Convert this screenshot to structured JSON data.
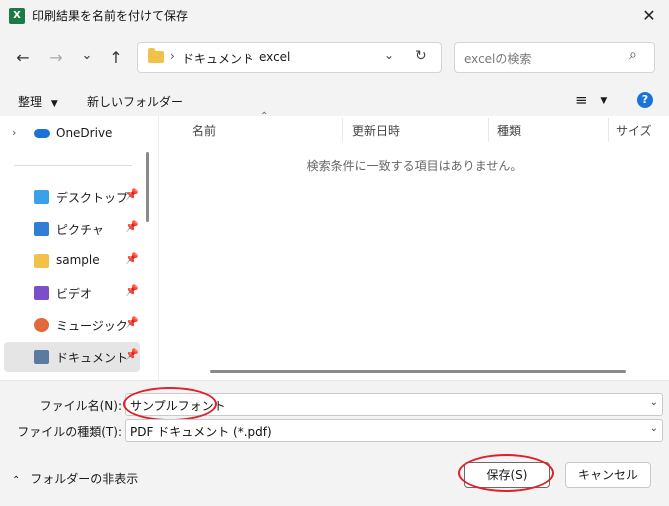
{
  "window": {
    "title": "印刷結果を名前を付けて保存",
    "app_icon_letter": "X"
  },
  "nav": {
    "back": "←",
    "forward": "→",
    "recent": "⌄",
    "up": "↑",
    "breadcrumb": [
      "ドキュメント",
      "excel"
    ],
    "chevron": "›",
    "search_placeholder": "excelの検索"
  },
  "toolbar": {
    "organize": "整理",
    "new_folder": "新しいフォルダー"
  },
  "sidebar": {
    "top": {
      "label": "OneDrive",
      "icon": "cloud-icon"
    },
    "items": [
      {
        "label": "デスクトップ",
        "icon": "desktop-icon",
        "color": "#3aa0e8"
      },
      {
        "label": "ピクチャ",
        "icon": "pictures-icon",
        "color": "#2f7fd6"
      },
      {
        "label": "sample",
        "icon": "folder-icon",
        "color": "#f3c14a"
      },
      {
        "label": "ビデオ",
        "icon": "video-icon",
        "color": "#7a4fc9"
      },
      {
        "label": "ミュージック",
        "icon": "music-icon",
        "color": "#e06a3a"
      },
      {
        "label": "ドキュメント",
        "icon": "documents-icon",
        "color": "#5a7aa0"
      }
    ]
  },
  "columns": [
    "名前",
    "更新日時",
    "種類",
    "サイズ"
  ],
  "empty_message": "検索条件に一致する項目はありません。",
  "form": {
    "filename_label": "ファイル名(N):",
    "filename_value": "サンプルフォント",
    "filetype_label": "ファイルの種類(T):",
    "filetype_value": "PDF ドキュメント (*.pdf)",
    "hide_folders": "フォルダーの非表示",
    "save": "保存(S)",
    "cancel": "キャンセル"
  }
}
